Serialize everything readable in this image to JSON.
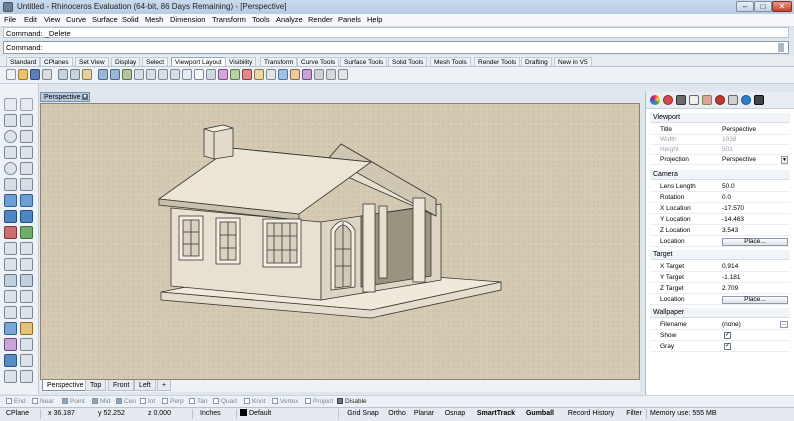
{
  "window": {
    "title": "Untitled - Rhinoceros Evaluation (64-bit, 86 Days Remaining) - [Perspective]",
    "minimize": "–",
    "maximize": "□",
    "close": "✕"
  },
  "menu": [
    "File",
    "Edit",
    "View",
    "Curve",
    "Surface",
    "Solid",
    "Mesh",
    "Dimension",
    "Transform",
    "Tools",
    "Analyze",
    "Render",
    "Panels",
    "Help"
  ],
  "command": {
    "history": "Command: _Delete",
    "prompt": "Command:",
    "value": ""
  },
  "toolbar_tabs": [
    "Standard",
    "CPlanes",
    "Set View",
    "Display",
    "Select",
    "Viewport Layout",
    "Visibility",
    "Transform",
    "Curve Tools",
    "Surface Tools",
    "Solid Tools",
    "Mesh Tools",
    "Render Tools",
    "Drafting",
    "New in V5"
  ],
  "active_toolbar_tab": "Viewport Layout",
  "viewport": {
    "title": "Perspective",
    "tabs": [
      "Perspective",
      "Top",
      "Front",
      "Left"
    ],
    "add_tab": "+"
  },
  "osnaps": [
    {
      "label": "End",
      "on": false
    },
    {
      "label": "Near",
      "on": false
    },
    {
      "label": "Point",
      "on": true
    },
    {
      "label": "Mid",
      "on": true
    },
    {
      "label": "Cen",
      "on": true
    },
    {
      "label": "Int",
      "on": false
    },
    {
      "label": "Perp",
      "on": false
    },
    {
      "label": "Tan",
      "on": false
    },
    {
      "label": "Quad",
      "on": false
    },
    {
      "label": "Knot",
      "on": false
    },
    {
      "label": "Vertex",
      "on": false
    },
    {
      "label": "Project",
      "on": false
    },
    {
      "label": "Disable",
      "on": true
    }
  ],
  "status": {
    "cplane": "CPlane",
    "x": "x 36.187",
    "y": "y 52.252",
    "z": "z 0.000",
    "units": "Inches",
    "layer": "Default",
    "buttons": [
      "Grid Snap",
      "Ortho",
      "Planar",
      "Osnap",
      "SmartTrack",
      "Gumball",
      "Record History",
      "Filter"
    ],
    "bold_buttons": [
      "SmartTrack",
      "Gumball"
    ],
    "memory": "Memory use: 555 MB"
  },
  "properties": {
    "viewport_section": "Viewport",
    "title_label": "Title",
    "title_value": "Perspective",
    "width_label": "Width",
    "width_value": "1038",
    "height_label": "Height",
    "height_value": "501",
    "projection_label": "Projection",
    "projection_value": "Perspective",
    "camera_section": "Camera",
    "lens_label": "Lens Length",
    "lens_value": "50.0",
    "rotation_label": "Rotation",
    "rotation_value": "0.0",
    "xloc_label": "X Location",
    "xloc_value": "-17.570",
    "yloc_label": "Y Location",
    "yloc_value": "-14.463",
    "zloc_label": "Z Location",
    "zloc_value": "3.543",
    "location_label": "Location",
    "place_label": "Place...",
    "target_section": "Target",
    "xt_label": "X Target",
    "xt_value": "0.914",
    "yt_label": "Y Target",
    "yt_value": "-1.181",
    "zt_label": "Z Target",
    "zt_value": "2.709",
    "tloc_label": "Location",
    "tplace_label": "Place...",
    "wallpaper_section": "Wallpaper",
    "filename_label": "Filename",
    "filename_value": "(none)",
    "show_label": "Show",
    "show_checked": "✓",
    "gray_label": "Gray",
    "gray_checked": "✓",
    "dots": "..."
  }
}
